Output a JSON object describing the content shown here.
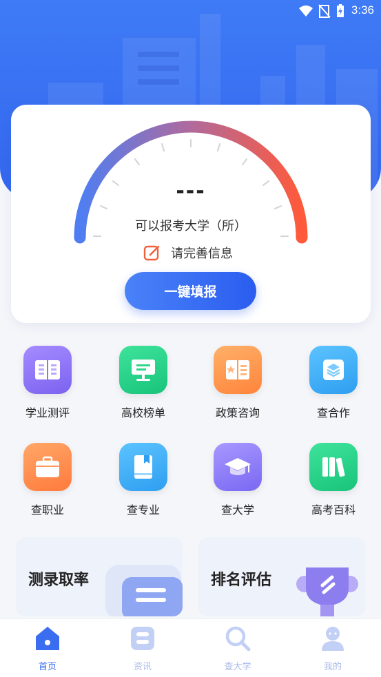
{
  "status_bar": {
    "time": "3:36"
  },
  "gauge": {
    "value": "---",
    "label": "可以报考大学（所）",
    "complete_text": "请完善信息",
    "button": "一键填报"
  },
  "grid": [
    {
      "label": "学业测评",
      "icon": "book-icon",
      "color": "#8d73f6"
    },
    {
      "label": "高校榜单",
      "icon": "monitor-icon",
      "color": "#2fd58a"
    },
    {
      "label": "政策咨询",
      "icon": "news-icon",
      "color": "#ff9a4f"
    },
    {
      "label": "查合作",
      "icon": "layers-icon",
      "color": "#3fb0f5"
    },
    {
      "label": "查职业",
      "icon": "briefcase-icon",
      "color": "#ff8a48"
    },
    {
      "label": "查专业",
      "icon": "bookmark-book-icon",
      "color": "#3fb0f5"
    },
    {
      "label": "查大学",
      "icon": "graduation-cap-icon",
      "color": "#8a7bf8"
    },
    {
      "label": "高考百科",
      "icon": "books-icon",
      "color": "#2fd58a"
    }
  ],
  "promos": [
    {
      "title": "测录取率"
    },
    {
      "title": "排名评估"
    }
  ],
  "tabs": [
    {
      "label": "首页",
      "icon": "home-icon",
      "active": true
    },
    {
      "label": "资讯",
      "icon": "news-icon",
      "active": false
    },
    {
      "label": "查大学",
      "icon": "search-icon",
      "active": false
    },
    {
      "label": "我的",
      "icon": "user-icon",
      "active": false
    }
  ]
}
